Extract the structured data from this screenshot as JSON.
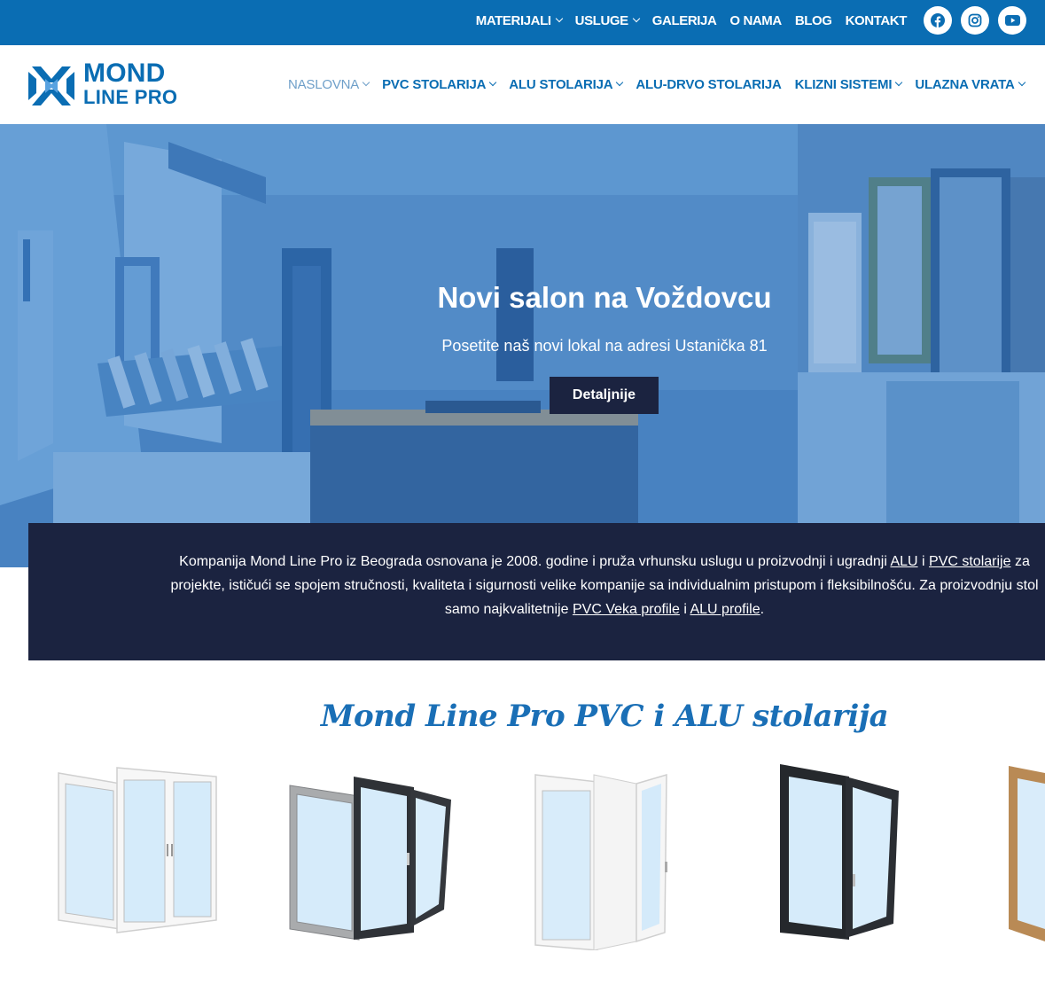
{
  "colors": {
    "brand_blue": "#0a6db3",
    "navy": "#1b2340",
    "active_nav": "#6e9fc9",
    "section_title": "#1a6fb6"
  },
  "topbar": {
    "items": [
      {
        "label": "MATERIJALI",
        "has_dropdown": true
      },
      {
        "label": "USLUGE",
        "has_dropdown": true
      },
      {
        "label": "GALERIJA",
        "has_dropdown": false
      },
      {
        "label": "O NAMA",
        "has_dropdown": false
      },
      {
        "label": "BLOG",
        "has_dropdown": false
      },
      {
        "label": "KONTAKT",
        "has_dropdown": false
      }
    ],
    "social": [
      "facebook-icon",
      "instagram-icon",
      "youtube-icon"
    ]
  },
  "logo": {
    "line1": "MOND",
    "line2": "LINE PRO"
  },
  "mainnav": {
    "items": [
      {
        "label": "NASLOVNA",
        "has_dropdown": true,
        "active": true
      },
      {
        "label": "PVC STOLARIJA",
        "has_dropdown": true
      },
      {
        "label": "ALU STOLARIJA",
        "has_dropdown": true
      },
      {
        "label": "ALU-DRVO STOLARIJA",
        "has_dropdown": false
      },
      {
        "label": "KLIZNI SISTEMI",
        "has_dropdown": true
      },
      {
        "label": "ULAZNA VRATA",
        "has_dropdown": true
      }
    ]
  },
  "hero": {
    "title": "Novi salon na Voždovcu",
    "subtitle": "Posetite naš novi lokal na adresi Ustanička 81",
    "button": "Detaljnije"
  },
  "intro": {
    "l1_a": "Kompanija Mond Line Pro iz Beograda osnovana je 2008. godine i pruža vrhunsku uslugu u proizvodnji i ugradnji ",
    "link_alu": "ALU",
    "l1_b": " i ",
    "link_pvc": "PVC stolarije",
    "l1_c": " za",
    "l2": "projekte, ističući se spojem stručnosti, kvaliteta i sigurnosti velike kompanije sa individualnim pristupom i fleksibilnošću. Za proizvodnju stol",
    "l3_a": "samo najkvalitetnije ",
    "link_veka": "PVC Veka profile",
    "l3_b": " i ",
    "link_aluprofile": "ALU profile",
    "l3_c": "."
  },
  "section": {
    "title": "Mond Line Pro PVC i ALU stolarija"
  },
  "products": [
    {
      "name": "white-double-window"
    },
    {
      "name": "grey-anthracite-window"
    },
    {
      "name": "white-open-window"
    },
    {
      "name": "black-tilt-window"
    },
    {
      "name": "wood-window"
    }
  ]
}
